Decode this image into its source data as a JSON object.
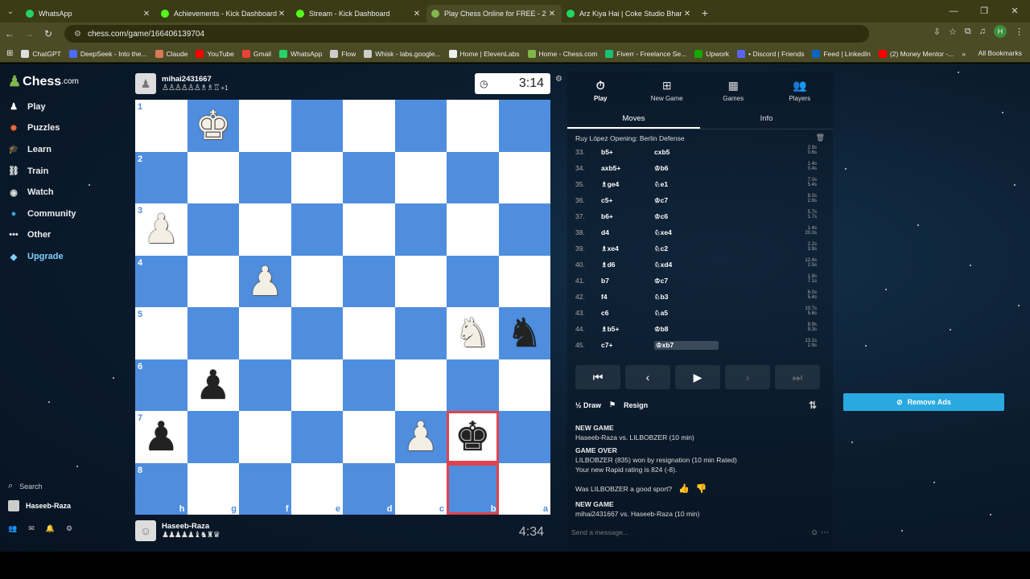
{
  "browser": {
    "tabs": [
      {
        "label": "WhatsApp",
        "color": "#25d366",
        "active": false
      },
      {
        "label": "Achievements - Kick Dashboard",
        "color": "#53fc18",
        "active": false
      },
      {
        "label": "Stream - Kick Dashboard",
        "color": "#53fc18",
        "active": false
      },
      {
        "label": "Play Chess Online for FREE - 2 P",
        "color": "#81b64c",
        "active": true
      },
      {
        "label": "Arz Kiya Hai | Coke Studio Bhar",
        "color": "#1ed760",
        "active": false
      }
    ],
    "url": "chess.com/game/166406139704",
    "profile_initial": "H",
    "bookmarks": [
      {
        "label": "ChatGPT",
        "color": "#ddd"
      },
      {
        "label": "DeepSeek - Into the...",
        "color": "#4d6bfe"
      },
      {
        "label": "Claude",
        "color": "#d97757"
      },
      {
        "label": "YouTube",
        "color": "#ff0000"
      },
      {
        "label": "Gmail",
        "color": "#ea4335"
      },
      {
        "label": "WhatsApp",
        "color": "#25d366"
      },
      {
        "label": "Flow",
        "color": "#ccc"
      },
      {
        "label": "Whisk - labs.google...",
        "color": "#ccc"
      },
      {
        "label": "Home | ElevenLabs",
        "color": "#eee"
      },
      {
        "label": "Home - Chess.com",
        "color": "#81b64c"
      },
      {
        "label": "Fiverr - Freelance Se...",
        "color": "#1dbf73"
      },
      {
        "label": "Upwork",
        "color": "#14a800"
      },
      {
        "label": "• Discord | Friends",
        "color": "#5865f2"
      },
      {
        "label": "Feed | LinkedIn",
        "color": "#0a66c2"
      },
      {
        "label": "(2) Money Mentor -...",
        "color": "#ff0000"
      }
    ],
    "all_bookmarks": "All Bookmarks"
  },
  "sidebar": {
    "logo": "Chess",
    "logo_suffix": ".com",
    "items": [
      {
        "label": "Play",
        "icon": "♟",
        "color": "#fff"
      },
      {
        "label": "Puzzles",
        "icon": "✸",
        "color": "#f56a3a"
      },
      {
        "label": "Learn",
        "icon": "🎓",
        "color": "#3aa7e0"
      },
      {
        "label": "Train",
        "icon": "⛓",
        "color": "#ddd"
      },
      {
        "label": "Watch",
        "icon": "◉",
        "color": "#ddd"
      },
      {
        "label": "Community",
        "icon": "●",
        "color": "#3aa7e0"
      },
      {
        "label": "Other",
        "icon": "•••",
        "color": "#ddd"
      },
      {
        "label": "Upgrade",
        "icon": "◆",
        "color": "#7fd0ff"
      }
    ],
    "search": "Search",
    "user": "Haseeb-Raza"
  },
  "top_player": {
    "name": "mihai2431667",
    "captured": "♙♙♙♙♙♙♗♗♖",
    "material": "+1",
    "clock": "3:14"
  },
  "bottom_player": {
    "name": "Haseeb-Raza",
    "captured": "♟♟♟♟♟♝♞♜♛",
    "clock": "4:34"
  },
  "board": {
    "ranks": [
      "1",
      "2",
      "3",
      "4",
      "5",
      "6",
      "7",
      "8"
    ],
    "files": [
      "h",
      "g",
      "f",
      "e",
      "d",
      "c",
      "b",
      "a"
    ],
    "pieces": [
      {
        "sq": "g1",
        "glyph": "♚",
        "side": "w"
      },
      {
        "sq": "h3",
        "glyph": "♟",
        "side": "w"
      },
      {
        "sq": "f4",
        "glyph": "♟",
        "side": "w"
      },
      {
        "sq": "b5",
        "glyph": "♞",
        "side": "w"
      },
      {
        "sq": "a5",
        "glyph": "♞",
        "side": "b"
      },
      {
        "sq": "g6",
        "glyph": "♟",
        "side": "b"
      },
      {
        "sq": "h7",
        "glyph": "♟",
        "side": "b"
      },
      {
        "sq": "c7",
        "glyph": "♟",
        "side": "w"
      },
      {
        "sq": "b7",
        "glyph": "♚",
        "side": "b"
      }
    ],
    "highlight": [
      "b7",
      "b8"
    ]
  },
  "panel": {
    "tabs": [
      {
        "label": "Play",
        "icon": "⏱"
      },
      {
        "label": "New Game",
        "icon": "⊞"
      },
      {
        "label": "Games",
        "icon": "▦"
      },
      {
        "label": "Players",
        "icon": "👥"
      }
    ],
    "subtabs": [
      "Moves",
      "Info"
    ],
    "opening": "Ruy López Opening: Berlin Defense",
    "moves": [
      {
        "n": "33.",
        "w": "b5+",
        "b": "cxb5",
        "t": "2.9s 0.6s"
      },
      {
        "n": "34.",
        "w": "axb5+",
        "b": "♔b6",
        "t": "1.4s 0.4s"
      },
      {
        "n": "35.",
        "w": "♗ge4",
        "b": "♘e1",
        "t": "7.0s 5.4s"
      },
      {
        "n": "36.",
        "w": "c5+",
        "b": "♔c7",
        "t": "8.0s 2.6s"
      },
      {
        "n": "37.",
        "w": "b6+",
        "b": "♔c6",
        "t": "5.7s 1.7s"
      },
      {
        "n": "38.",
        "w": "d4",
        "b": "♘xe4",
        "t": "1.4s 20.3s"
      },
      {
        "n": "39.",
        "w": "♗xe4",
        "b": "♘c2",
        "t": "2.2s 3.9s"
      },
      {
        "n": "40.",
        "w": "♗d6",
        "b": "♘xd4",
        "t": "12.4s 2.5s"
      },
      {
        "n": "41.",
        "w": "b7",
        "b": "♔c7",
        "t": "1.8s 7.1s"
      },
      {
        "n": "42.",
        "w": "f4",
        "b": "♘b3",
        "t": "6.0s 5.4s"
      },
      {
        "n": "43.",
        "w": "c6",
        "b": "♘a5",
        "t": "10.7s 5.6s"
      },
      {
        "n": "44.",
        "w": "♗b5+",
        "b": "♔b8",
        "t": "8.9s 9.3s"
      },
      {
        "n": "45.",
        "w": "c7+",
        "b": "♔xb7",
        "t": "13.1s 2.9s"
      }
    ],
    "controls": [
      "⏮",
      "‹",
      "▶",
      "›",
      "⏭"
    ],
    "draw": "½ Draw",
    "resign": "Resign",
    "chat": [
      {
        "h": "NEW GAME",
        "l": "Haseeb-Raza vs. LILBOBZER (10 min)"
      },
      {
        "h": "GAME OVER",
        "l": "LILBOBZER (835) won by resignation (10 min Rated)",
        "l2": "Your new Rapid rating is 824 (-8)."
      }
    ],
    "sport_q": "Was LILBOBZER a good sport?",
    "chat2": {
      "h": "NEW GAME",
      "l": "mihai2431667 vs. Haseeb-Raza (10 min)"
    },
    "msg_placeholder": "Send a message..."
  },
  "remove_ads": "Remove Ads"
}
